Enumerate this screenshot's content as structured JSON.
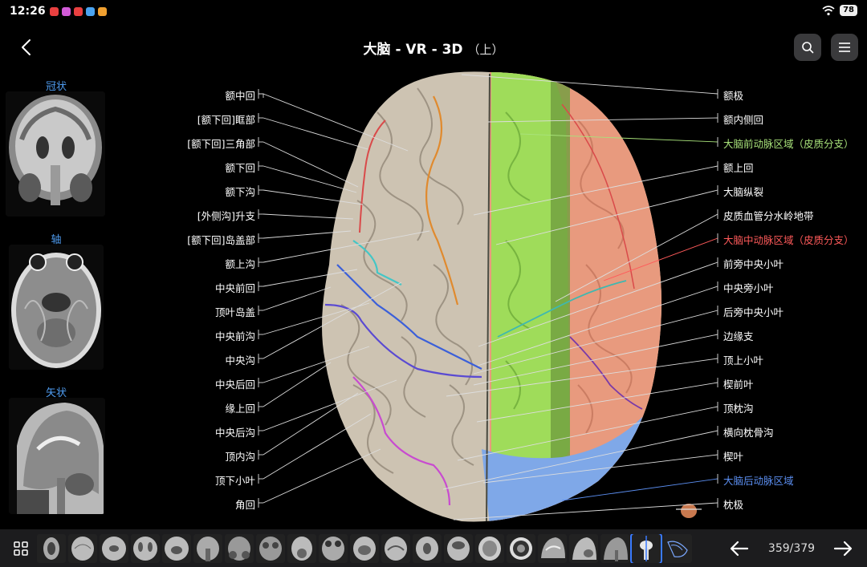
{
  "status": {
    "time": "12:26",
    "battery": "78"
  },
  "header": {
    "title": "大脑 - VR - 3D",
    "subtitle": "（上）"
  },
  "views": {
    "coronal": "冠状",
    "axial": "轴",
    "sagittal": "矢状"
  },
  "labels_left": [
    "额中回",
    "[额下回]眶部",
    "[额下回]三角部",
    "额下回",
    "额下沟",
    "[外侧沟]升支",
    "[额下回]岛盖部",
    "额上沟",
    "中央前回",
    "顶叶岛盖",
    "中央前沟",
    "中央沟",
    "中央后回",
    "缘上回",
    "中央后沟",
    "顶内沟",
    "顶下小叶",
    "角回"
  ],
  "labels_right": [
    "额极",
    "额内侧回",
    "大脑前动脉区域（皮质分支）",
    "额上回",
    "大脑纵裂",
    "皮质血管分水岭地带",
    "大脑中动脉区域（皮质分支）",
    "前旁中央小叶",
    "中央旁小叶",
    "后旁中央小叶",
    "边缘支",
    "顶上小叶",
    "楔前叶",
    "顶枕沟",
    "横向枕骨沟",
    "楔叶",
    "大脑后动脉区域",
    "枕极"
  ],
  "footer": {
    "counter": "359/379"
  },
  "colors": {
    "accent_blue": "#4f9cf0",
    "aca_territory": "#a8e27a",
    "mca_territory": "#ff5a5a",
    "pca_territory": "#5b8ef0"
  }
}
